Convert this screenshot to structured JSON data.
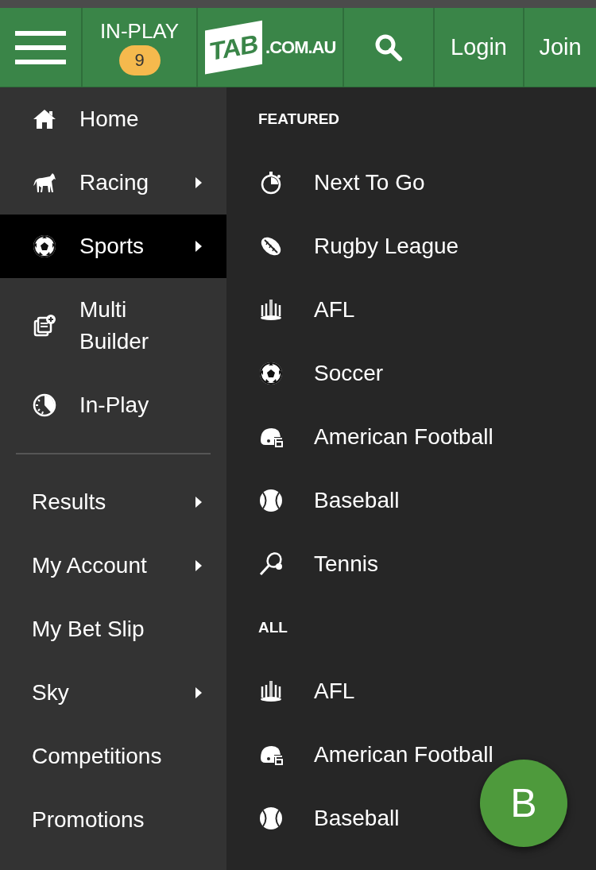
{
  "header": {
    "in_play": {
      "label": "IN-PLAY",
      "count": "9"
    },
    "logo": {
      "mark": "TAB",
      "domain": ".COM.AU"
    },
    "login": "Login",
    "join": "Join"
  },
  "menu": [
    {
      "label": "Home",
      "kind": "home",
      "submenu": false,
      "selected": false
    },
    {
      "label": "Racing",
      "kind": "horse",
      "submenu": true,
      "selected": false
    },
    {
      "label": "Sports",
      "kind": "soccer",
      "submenu": true,
      "selected": true
    },
    {
      "label": "Multi Builder",
      "kind": "multi",
      "submenu": false,
      "selected": false
    },
    {
      "label": "In-Play",
      "kind": "inplay",
      "submenu": false,
      "selected": false
    }
  ],
  "menu_more": [
    {
      "label": "Results",
      "submenu": true
    },
    {
      "label": "My Account",
      "submenu": true
    },
    {
      "label": "My Bet Slip",
      "submenu": false
    },
    {
      "label": "Sky",
      "submenu": true
    },
    {
      "label": "Competitions",
      "submenu": false
    },
    {
      "label": "Promotions",
      "submenu": false
    }
  ],
  "sections": [
    {
      "title": "FEATURED",
      "items": [
        {
          "label": "Next To Go",
          "kind": "stopwatch"
        },
        {
          "label": "Rugby League",
          "kind": "rugby"
        },
        {
          "label": "AFL",
          "kind": "afl"
        },
        {
          "label": "Soccer",
          "kind": "soccer"
        },
        {
          "label": "American Football",
          "kind": "helmet"
        },
        {
          "label": "Baseball",
          "kind": "baseball"
        },
        {
          "label": "Tennis",
          "kind": "tennis"
        }
      ]
    },
    {
      "title": "ALL",
      "items": [
        {
          "label": "AFL",
          "kind": "afl"
        },
        {
          "label": "American Football",
          "kind": "helmet"
        },
        {
          "label": "Baseball",
          "kind": "baseball"
        }
      ]
    }
  ],
  "fab": {
    "label": "B"
  }
}
